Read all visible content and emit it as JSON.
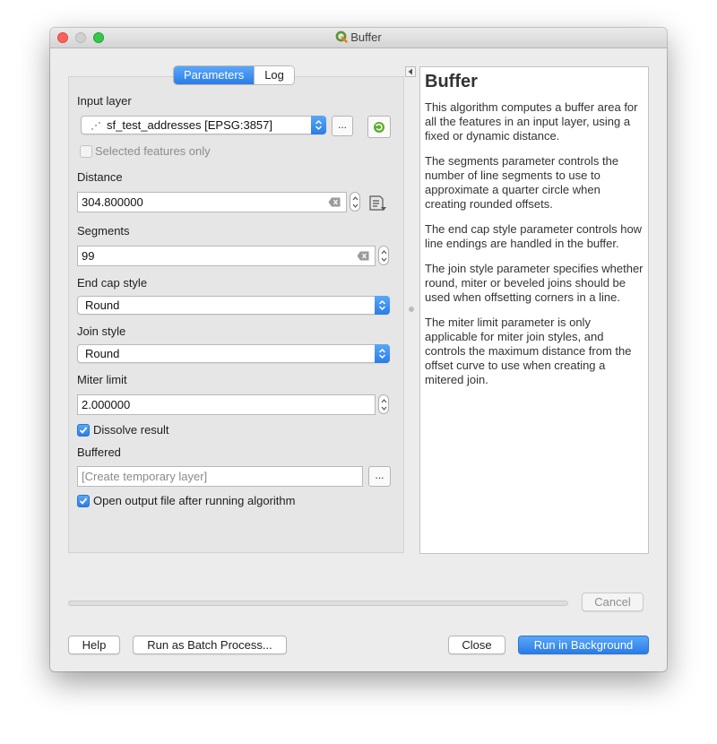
{
  "window": {
    "title": "Buffer"
  },
  "tabs": {
    "parameters": "Parameters",
    "log": "Log"
  },
  "input_layer": {
    "label": "Input layer",
    "value": "sf_test_addresses [EPSG:3857]",
    "browse": "...",
    "selected_only": {
      "label": "Selected features only",
      "checked": false
    }
  },
  "distance": {
    "label": "Distance",
    "value": "304.800000"
  },
  "segments": {
    "label": "Segments",
    "value": "99"
  },
  "end_cap": {
    "label": "End cap style",
    "value": "Round"
  },
  "join": {
    "label": "Join style",
    "value": "Round"
  },
  "miter": {
    "label": "Miter limit",
    "value": "2.000000"
  },
  "dissolve": {
    "label": "Dissolve result",
    "checked": true
  },
  "buffered": {
    "label": "Buffered",
    "placeholder": "[Create temporary layer]",
    "browse": "..."
  },
  "open_output": {
    "label": "Open output file after running algorithm",
    "checked": true
  },
  "help": {
    "title": "Buffer",
    "paragraphs": [
      "This algorithm computes a buffer area for all the features in an input layer, using a fixed or dynamic distance.",
      "The segments parameter controls the number of line segments to use to approximate a quarter circle when creating rounded offsets.",
      "The end cap style parameter controls how line endings are handled in the buffer.",
      "The join style parameter specifies whether round, miter or beveled joins should be used when offsetting corners in a line.",
      "The miter limit parameter is only applicable for miter join styles, and controls the maximum distance from the offset curve to use when creating a mitered join."
    ]
  },
  "progress": {
    "value": 0
  },
  "buttons": {
    "cancel": "Cancel",
    "help": "Help",
    "batch": "Run as Batch Process...",
    "close": "Close",
    "run": "Run in Background"
  },
  "colors": {
    "accent": "#2a7de6",
    "window_bg": "#ececec"
  }
}
